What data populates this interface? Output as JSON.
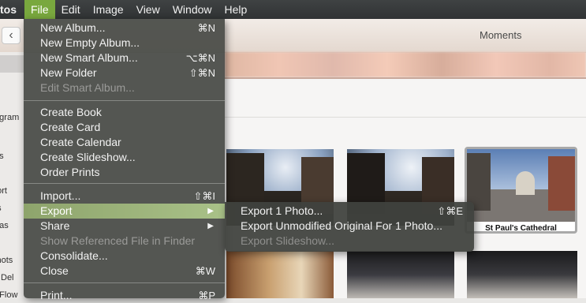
{
  "menubar": {
    "app": "tos",
    "items": [
      {
        "label": "File",
        "active": true
      },
      {
        "label": "Edit",
        "active": false
      },
      {
        "label": "Image",
        "active": false
      },
      {
        "label": "View",
        "active": false
      },
      {
        "label": "Window",
        "active": false
      },
      {
        "label": "Help",
        "active": false
      }
    ]
  },
  "toolbar": {
    "back_glyph": "‹",
    "moments_tab": "Moments"
  },
  "sidebar": {
    "rows": [
      "y",
      "tagram",
      "tos",
      "port",
      "es",
      "mas",
      "shots",
      "ly Del",
      "n Flow"
    ]
  },
  "file_menu": {
    "items": [
      {
        "label": "New Album...",
        "shortcut": "⌘N",
        "disabled": false
      },
      {
        "label": "New Empty Album...",
        "shortcut": "",
        "disabled": false
      },
      {
        "label": "New Smart Album...",
        "shortcut": "⌥⌘N",
        "disabled": false
      },
      {
        "label": "New Folder",
        "shortcut": "⇧⌘N",
        "disabled": false
      },
      {
        "label": "Edit Smart Album...",
        "shortcut": "",
        "disabled": true
      },
      {
        "label": "Create Book",
        "shortcut": "",
        "disabled": false
      },
      {
        "label": "Create Card",
        "shortcut": "",
        "disabled": false
      },
      {
        "label": "Create Calendar",
        "shortcut": "",
        "disabled": false
      },
      {
        "label": "Create Slideshow...",
        "shortcut": "",
        "disabled": false
      },
      {
        "label": "Order Prints",
        "shortcut": "",
        "disabled": false
      },
      {
        "label": "Import...",
        "shortcut": "⇧⌘I",
        "disabled": false
      },
      {
        "label": "Export",
        "shortcut": "▶",
        "disabled": false
      },
      {
        "label": "Share",
        "shortcut": "▶",
        "disabled": false
      },
      {
        "label": "Show Referenced File in Finder",
        "shortcut": "",
        "disabled": true
      },
      {
        "label": "Consolidate...",
        "shortcut": "",
        "disabled": false
      },
      {
        "label": "Close",
        "shortcut": "⌘W",
        "disabled": false
      },
      {
        "label": "Print...",
        "shortcut": "⌘P",
        "disabled": false
      }
    ]
  },
  "export_submenu": {
    "items": [
      {
        "label": "Export 1 Photo...",
        "shortcut": "⇧⌘E",
        "disabled": false
      },
      {
        "label": "Export Unmodified Original For 1 Photo...",
        "shortcut": "",
        "disabled": false
      },
      {
        "label": "Export Slideshow...",
        "shortcut": "",
        "disabled": true
      }
    ]
  },
  "photos": {
    "selected_caption": "St Paul's Cathedral"
  },
  "colors": {
    "menubar_bg": "#303334",
    "active_menu": "#79a83e",
    "menu_bg": "#484a46",
    "highlight": "#a9c188",
    "selection_border": "#a9a9a9"
  }
}
